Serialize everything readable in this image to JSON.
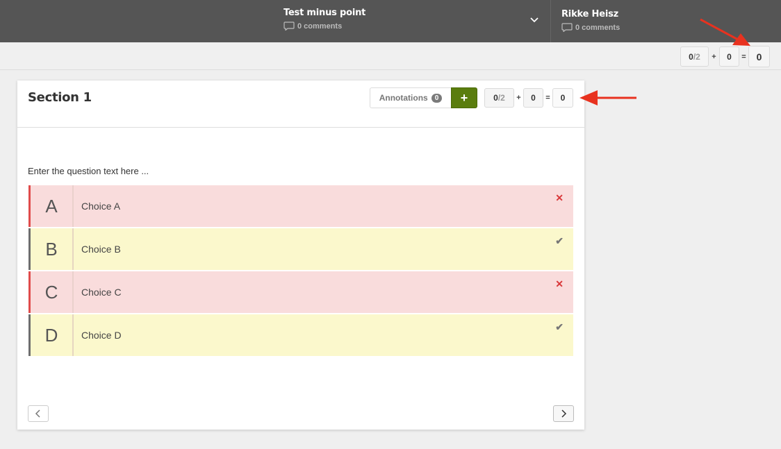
{
  "topbar": {
    "item1": {
      "title": "Test minus point",
      "comments": "0 comments"
    },
    "item2": {
      "title": "Rikke Heisz",
      "comments": "0 comments"
    }
  },
  "total_score": {
    "points": "0",
    "max": "/2",
    "plus": "+",
    "bonus": "0",
    "equals": "=",
    "total": "0"
  },
  "section": {
    "title": "Section 1",
    "annotations_label": "Annotations",
    "annotations_count": "0",
    "add_label": "+",
    "score": {
      "points": "0",
      "max": "/2",
      "plus": "+",
      "bonus": "0",
      "equals": "=",
      "total": "0"
    }
  },
  "question": {
    "text": "Enter the question text here ...",
    "choices": [
      {
        "letter": "A",
        "label": "Choice A",
        "mark": "✕",
        "state": "wrong"
      },
      {
        "letter": "B",
        "label": "Choice B",
        "mark": "✔",
        "state": "correct"
      },
      {
        "letter": "C",
        "label": "Choice C",
        "mark": "✕",
        "state": "wrong"
      },
      {
        "letter": "D",
        "label": "Choice D",
        "mark": "✔",
        "state": "correct"
      }
    ]
  },
  "colors": {
    "topbar": "#555555",
    "accent_green": "#5a7d0e",
    "wrong_bg": "#f9dcdc",
    "correct_bg": "#fbf8cc",
    "arrow": "#e8321f"
  }
}
